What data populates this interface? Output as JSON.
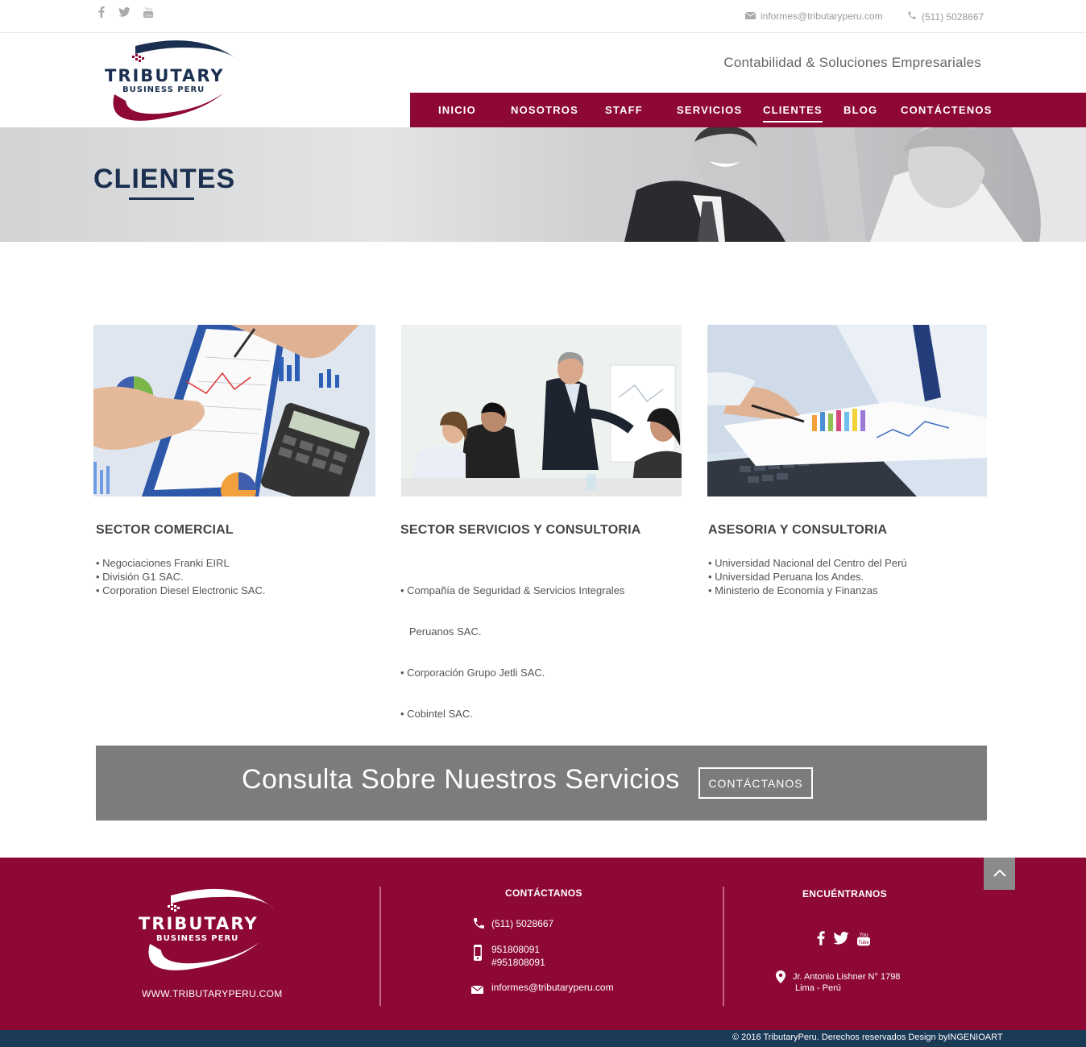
{
  "topbar": {
    "social": [
      {
        "icon": "facebook-icon",
        "glyph": "f"
      },
      {
        "icon": "twitter-icon",
        "glyph": "🐦"
      },
      {
        "icon": "youtube-icon",
        "glyph": "▶"
      }
    ],
    "email": "informes@tributaryperu.com",
    "phone": "(511) 5028667"
  },
  "header": {
    "logo_line1": "TRIBUTARY",
    "logo_line2": "BUSINESS PERU",
    "tagline": "Contabilidad & Soluciones Empresariales"
  },
  "nav": {
    "items": [
      {
        "label": "INICIO"
      },
      {
        "label": "NOSOTROS"
      },
      {
        "label": "STAFF"
      },
      {
        "label": "SERVICIOS"
      },
      {
        "label": "CLIENTES"
      },
      {
        "label": "BLOG"
      },
      {
        "label": "CONTÁCTENOS"
      }
    ],
    "active": "CLIENTES"
  },
  "hero": {
    "title": "CLIENTES"
  },
  "sectors": [
    {
      "title": "SECTOR COMERCIAL",
      "clients": [
        "• Negociaciones Franki EIRL",
        "• División G1 SAC.",
        "• Corporation Diesel Electronic SAC."
      ]
    },
    {
      "title": "SECTOR SERVICIOS Y CONSULTORIA",
      "clients": [
        "• Compañía de Seguridad & Servicios Integrales",
        "   Peruanos SAC.",
        "• Corporación Grupo Jetli SAC.",
        "• Cobintel SAC."
      ]
    },
    {
      "title": "ASESORIA Y CONSULTORIA",
      "clients": [
        "• Universidad Nacional del Centro del Perú",
        "• Universidad Peruana los Andes.",
        "• Ministerio de Economía y Finanzas"
      ]
    }
  ],
  "banner": {
    "text": "Consulta Sobre Nuestros Servicios",
    "button": "CONTÁCTANOS"
  },
  "footer": {
    "logo_line1": "TRIBUTARY",
    "logo_line2": "BUSINESS PERU",
    "url": "WWW.TRIBUTARYPERU.COM",
    "contact_heading": "CONTÁCTANOS",
    "phone": "(511) 5028667",
    "mobile1": "951808091",
    "mobile2": "#951808091",
    "email": "informes@tributaryperu.com",
    "find_heading": "ENCUÉNTRANOS",
    "address1": "Jr. Antonio Lishner N° 1798",
    "address2": "Lima - Perú",
    "copyright": "© 2016  TributaryPeru. Derechos reservados Design byINGENIOART"
  },
  "colors": {
    "brand": "#8e0834",
    "navy": "#1b3050",
    "banner_gray": "#7c7c7c"
  }
}
